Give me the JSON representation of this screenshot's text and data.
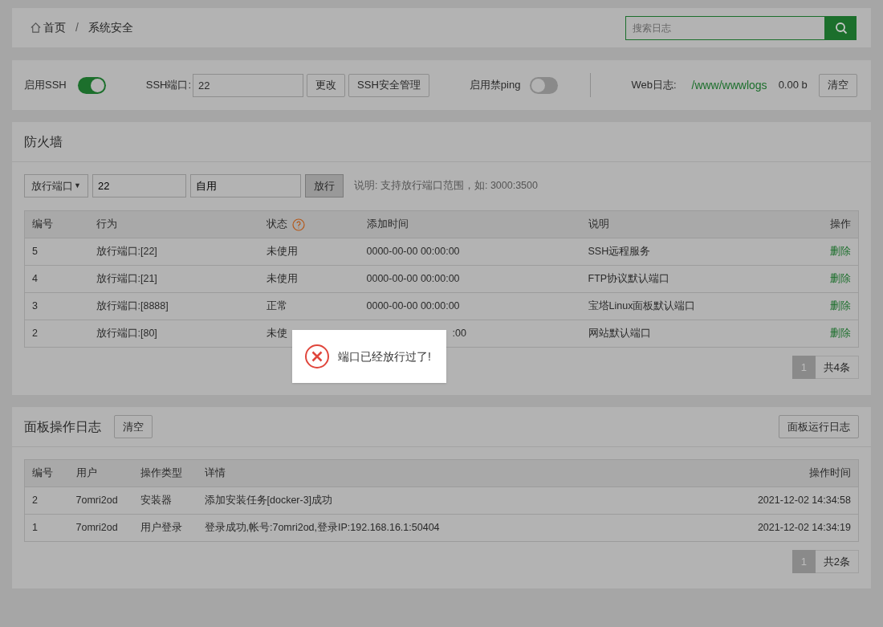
{
  "breadcrumb": [
    "首页",
    "系统安全"
  ],
  "breadcrumb_separator": "/",
  "search": {
    "placeholder": "搜索日志"
  },
  "ssh": {
    "label": "启用SSH",
    "on": true,
    "port_label": "SSH端口:",
    "port": "22",
    "change_button": "更改",
    "manage_button": "SSH安全管理",
    "ping_label": "启用禁ping",
    "ping_on": false,
    "weblog_label": "Web日志:",
    "weblog_path": "/www/wwwlogs",
    "weblog_size": "0.00 b",
    "clear_button": "清空"
  },
  "firewall": {
    "title": "防火墙",
    "type_select": "放行端口",
    "select_caret": "▼",
    "port": "22",
    "note": "自用",
    "submit": "放行",
    "hint": "说明: 支持放行端口范围，如: 3000:3500",
    "columns": [
      "编号",
      "行为",
      "状态",
      "添加时间",
      "说明",
      "操作"
    ],
    "rows": [
      {
        "id": "5",
        "action": "放行端口:[22]",
        "status": "未使用",
        "time": "0000-00-00 00:00:00",
        "desc": "SSH远程服务",
        "op": "删除"
      },
      {
        "id": "4",
        "action": "放行端口:[21]",
        "status": "未使用",
        "time": "0000-00-00 00:00:00",
        "desc": "FTP协议默认端口",
        "op": "删除"
      },
      {
        "id": "3",
        "action": "放行端口:[8888]",
        "status": "正常",
        "time": "0000-00-00 00:00:00",
        "desc": "宝塔Linux面板默认端口",
        "op": "删除"
      },
      {
        "id": "2",
        "action": "放行端口:[80]",
        "status": "未使",
        "time": ":00",
        "desc": "网站默认端口",
        "op": "删除"
      }
    ],
    "pages": [
      {
        "label": "1",
        "selected": true
      }
    ],
    "total": "共4条"
  },
  "logs": {
    "title": "面板操作日志",
    "clear_button": "清空",
    "run_log_button": "面板运行日志",
    "columns": [
      "编号",
      "用户",
      "操作类型",
      "详情",
      "操作时间"
    ],
    "rows": [
      {
        "id": "2",
        "user": "7omri2od",
        "type": "安装器",
        "detail": "添加安装任务[docker-3]成功",
        "time": "2021-12-02 14:34:58"
      },
      {
        "id": "1",
        "user": "7omri2od",
        "type": "用户登录",
        "detail": "登录成功,帐号:7omri2od,登录IP:192.168.16.1:50404",
        "time": "2021-12-02 14:34:19"
      }
    ],
    "pages": [
      {
        "label": "1",
        "selected": true
      }
    ],
    "total": "共2条"
  },
  "toast": {
    "kind": "error",
    "message": "端口已经放行过了!"
  }
}
